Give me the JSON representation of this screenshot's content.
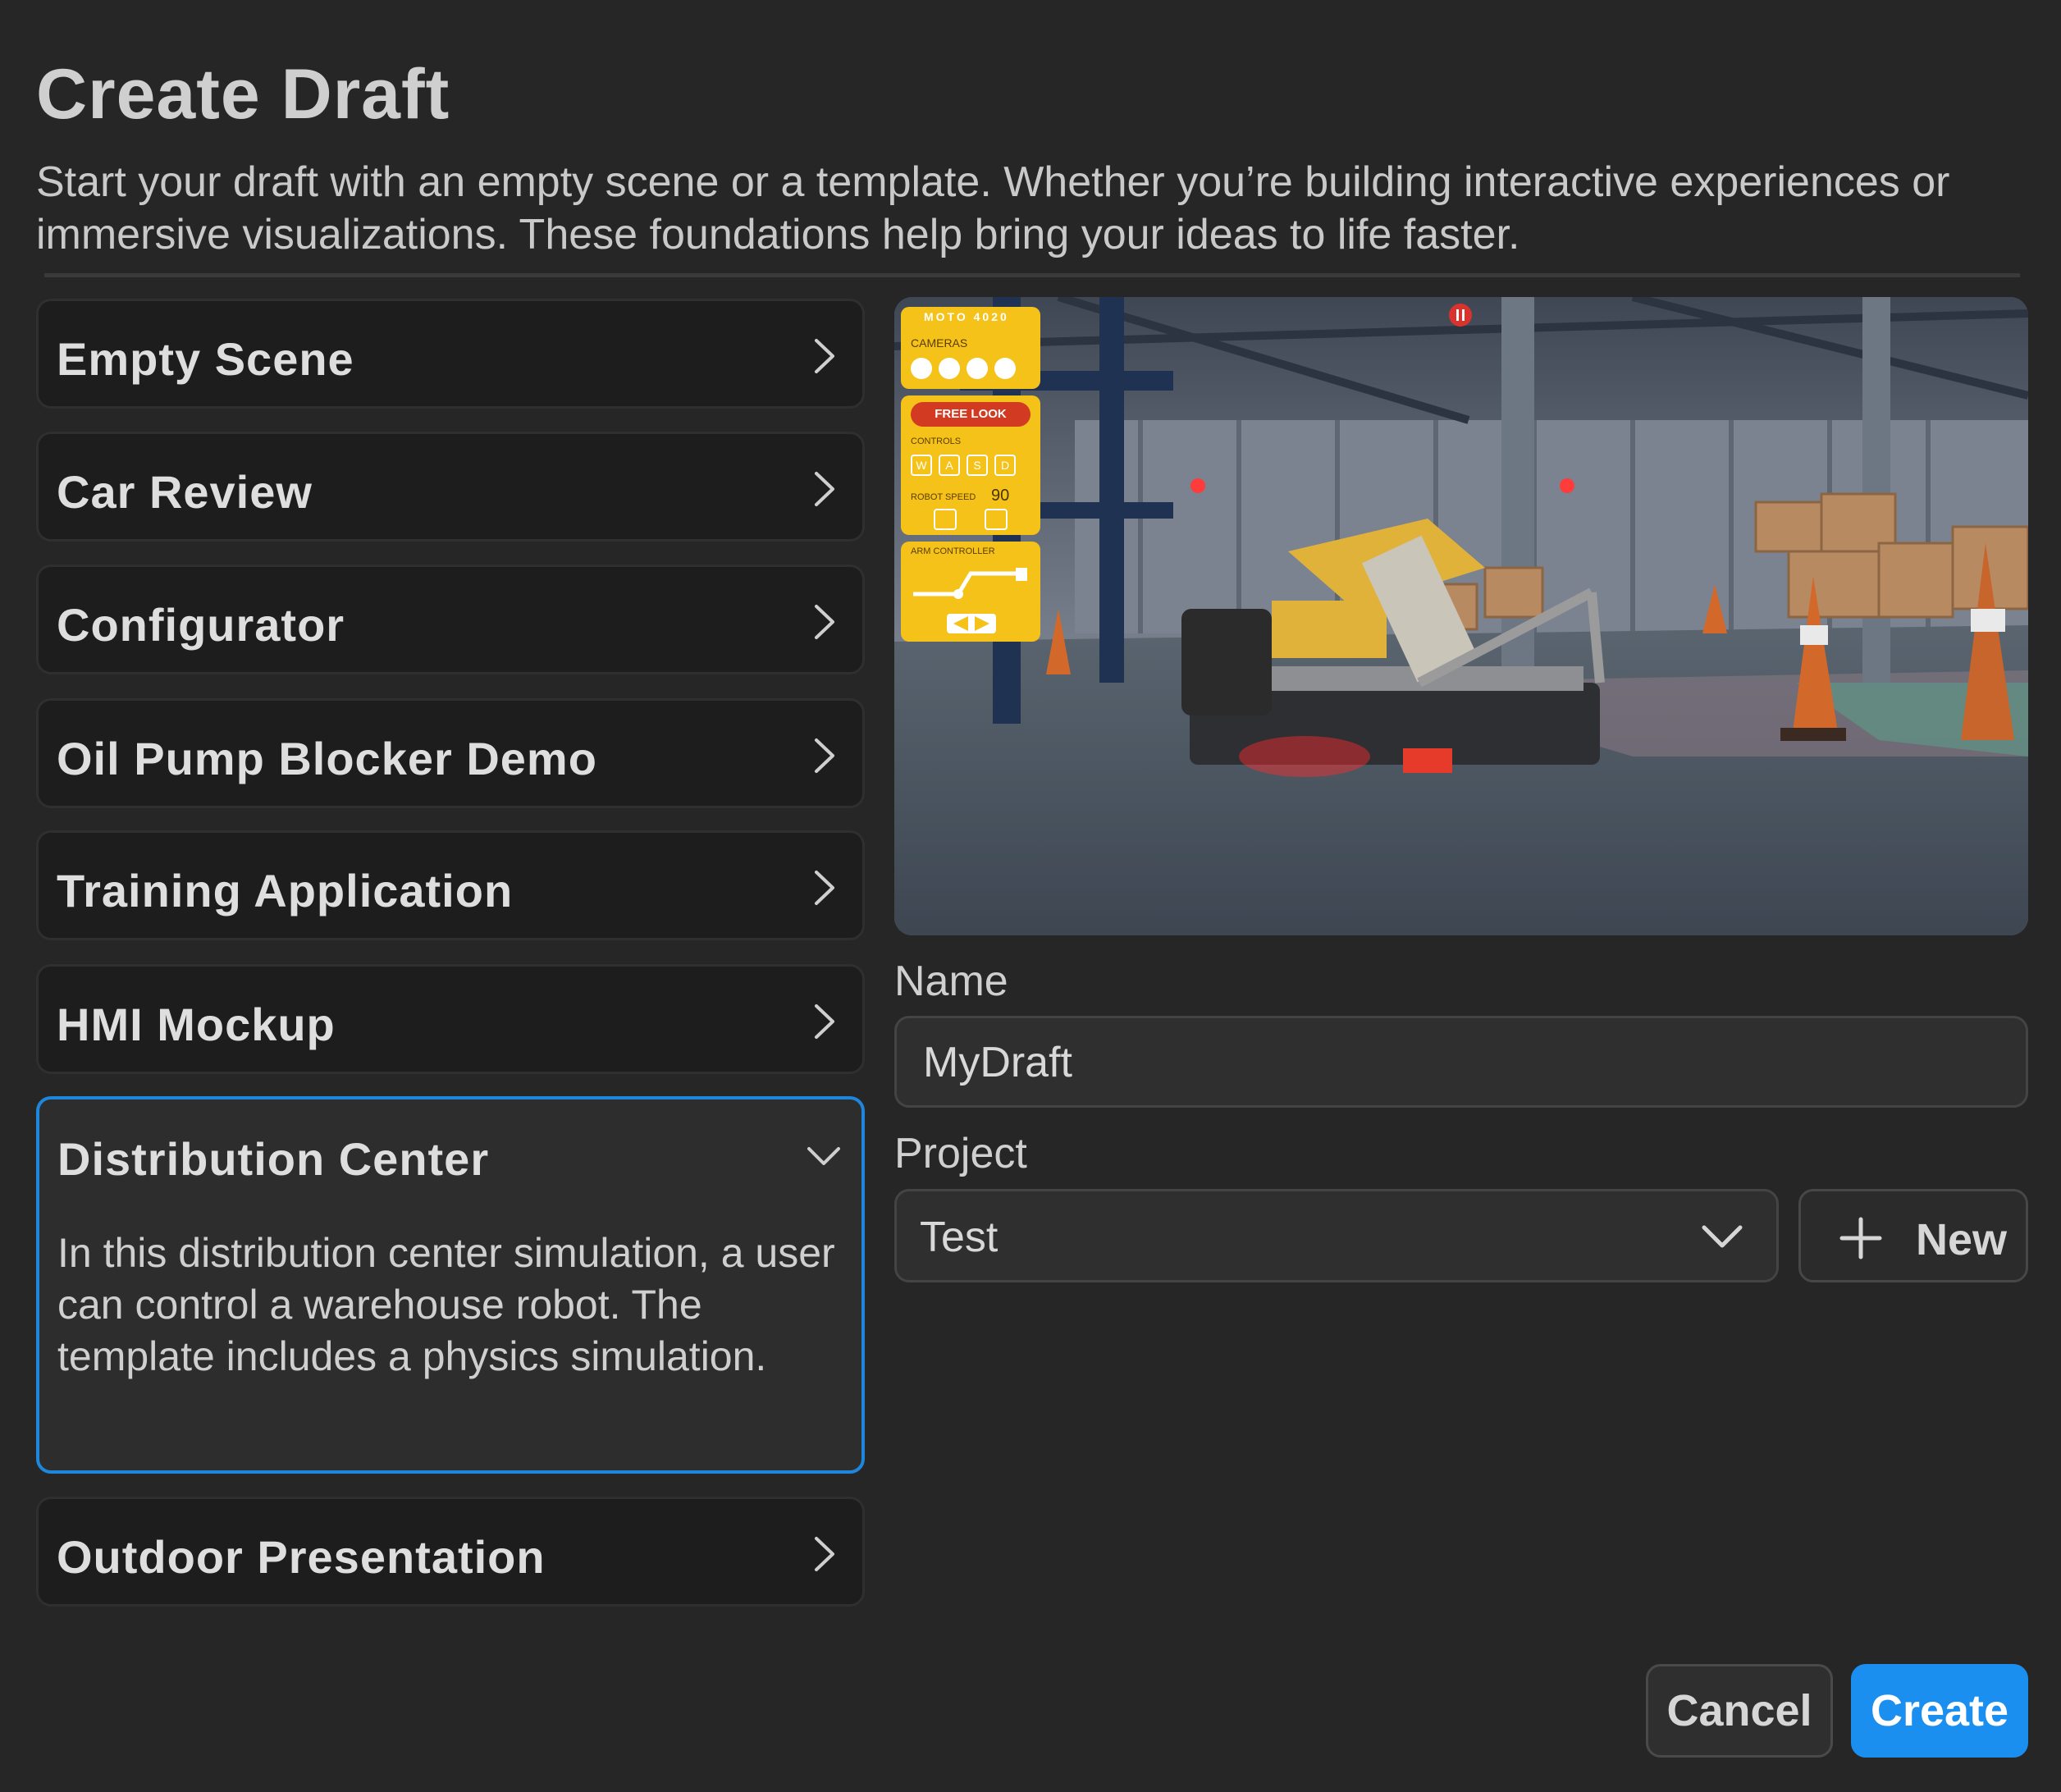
{
  "dialog": {
    "title": "Create Draft",
    "description": "Start your draft with an empty scene or a template. Whether you’re building interactive experiences or immersive visualizations. These foundations help bring your ideas to life faster."
  },
  "templates": [
    {
      "label": "Empty Scene",
      "state": "collapsed"
    },
    {
      "label": "Car Review",
      "state": "collapsed"
    },
    {
      "label": "Configurator",
      "state": "collapsed"
    },
    {
      "label": "Oil Pump Blocker Demo",
      "state": "collapsed"
    },
    {
      "label": "Training Application",
      "state": "collapsed"
    },
    {
      "label": "HMI Mockup",
      "state": "collapsed"
    },
    {
      "label": "Distribution Center",
      "state": "expanded",
      "detail": "In this distribution center simulation, a user can control a warehouse robot. The template includes a physics simulation."
    },
    {
      "label": "Outdoor Presentation",
      "state": "collapsed"
    }
  ],
  "preview": {
    "hud": {
      "brand": "MOTO 4020",
      "cameras_label": "CAMERAS",
      "free_look": "FREE LOOK",
      "controls_label": "CONTROLS",
      "keys": [
        "W",
        "A",
        "S",
        "D"
      ],
      "robot_speed_label": "ROBOT SPEED",
      "robot_speed_value": "90",
      "arm_controller_label": "ARM CONTROLLER"
    }
  },
  "form": {
    "name_label": "Name",
    "name_value": "MyDraft",
    "project_label": "Project",
    "project_value": "Test",
    "new_label": "New"
  },
  "actions": {
    "cancel": "Cancel",
    "create": "Create"
  },
  "colors": {
    "background": "#262626",
    "accent": "#1b8ff0",
    "selected_border": "#1e86dd",
    "hud_yellow": "#f5c21a"
  }
}
